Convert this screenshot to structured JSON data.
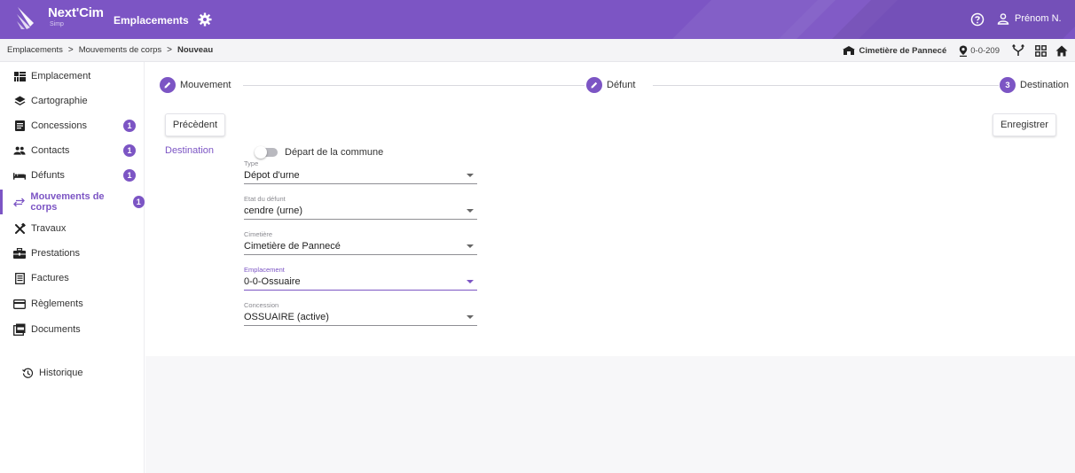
{
  "app": {
    "brand_name": "Next'Cim",
    "brand_sub": "Simp",
    "title": "Emplacements",
    "user_label": "Prénom N.",
    "accent_color": "#7c55c4"
  },
  "breadcrumb": {
    "items": [
      "Emplacements",
      "Mouvements de corps",
      "Nouveau"
    ],
    "separator": ">"
  },
  "context": {
    "cemetery": "Cimetière de Pannecé",
    "location_code": "0-0-209"
  },
  "sidebar": {
    "items": [
      {
        "label": "Emplacement",
        "icon": "grid-icon"
      },
      {
        "label": "Cartographie",
        "icon": "layers-icon"
      },
      {
        "label": "Concessions",
        "icon": "document-icon",
        "badge": "1"
      },
      {
        "label": "Contacts",
        "icon": "people-icon",
        "badge": "1"
      },
      {
        "label": "Défunts",
        "icon": "bed-icon",
        "badge": "1"
      },
      {
        "label": "Mouvements de corps",
        "icon": "transfer-icon",
        "badge": "1",
        "active": true
      },
      {
        "label": "Travaux",
        "icon": "tools-icon"
      },
      {
        "label": "Prestations",
        "icon": "briefcase-icon"
      },
      {
        "label": "Factures",
        "icon": "invoice-icon"
      },
      {
        "label": "Règlements",
        "icon": "card-icon"
      },
      {
        "label": "Documents",
        "icon": "pdf-icon"
      }
    ],
    "history_label": "Historique"
  },
  "stepper": {
    "steps": [
      {
        "label": "Mouvement",
        "state": "done"
      },
      {
        "label": "Défunt",
        "state": "done"
      },
      {
        "label": "Destination",
        "state": "current",
        "number": "3"
      }
    ]
  },
  "actions": {
    "previous_label": "Précèdent",
    "save_label": "Enregistrer"
  },
  "form": {
    "section_label": "Destination",
    "toggle_label": "Départ de la commune",
    "toggle_on": false,
    "fields": [
      {
        "label": "Type",
        "value": "Dépot d'urne"
      },
      {
        "label": "Etat du défunt",
        "value": "cendre (urne)"
      },
      {
        "label": "Cimetière",
        "value": "Cimetière de Pannecé"
      },
      {
        "label": "Emplacement",
        "value": "0-0-Ossuaire",
        "focused": true
      },
      {
        "label": "Concession",
        "value": "OSSUAIRE (active)"
      }
    ]
  }
}
